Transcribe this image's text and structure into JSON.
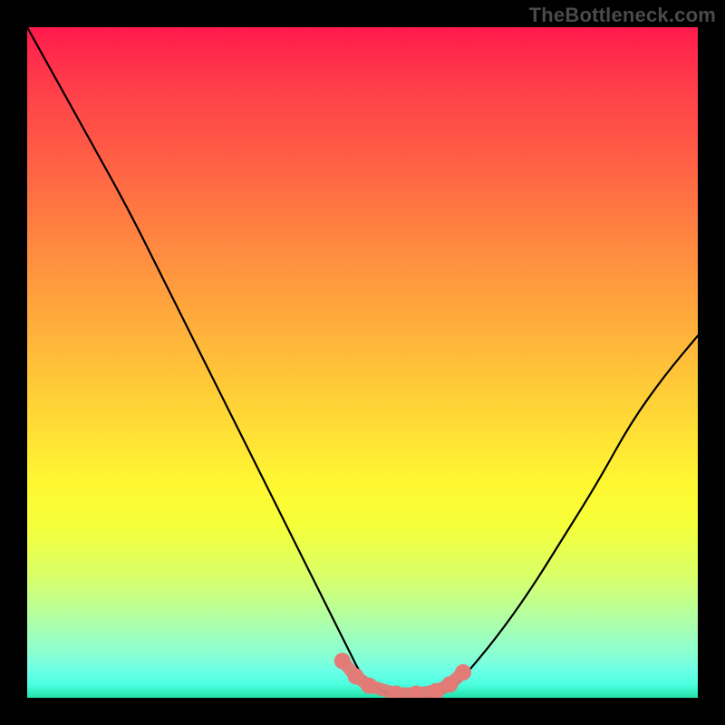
{
  "watermark": "TheBottleneck.com",
  "chart_data": {
    "type": "line",
    "title": "",
    "xlabel": "",
    "ylabel": "",
    "xlim": [
      0,
      100
    ],
    "ylim": [
      0,
      100
    ],
    "grid": false,
    "legend": false,
    "series": [
      {
        "name": "bottleneck-curve",
        "x": [
          0,
          5,
          10,
          15,
          20,
          25,
          30,
          35,
          40,
          45,
          48,
          50,
          53,
          55,
          57,
          60,
          63,
          65,
          70,
          75,
          80,
          85,
          90,
          95,
          100
        ],
        "values": [
          100,
          91,
          82,
          73,
          63,
          53,
          43,
          33,
          23,
          13,
          7,
          3,
          1,
          0,
          0,
          0,
          1,
          3,
          9,
          16,
          24,
          32,
          41,
          48,
          54
        ]
      },
      {
        "name": "good-zone-markers",
        "x": [
          47,
          49,
          51,
          55,
          58,
          61,
          63,
          65
        ],
        "values": [
          5.5,
          3.2,
          1.8,
          0.6,
          0.6,
          1.0,
          2.0,
          3.8
        ]
      }
    ],
    "annotations": []
  },
  "colors": {
    "curve_stroke": "#000000",
    "marker_fill": "#e27a76",
    "frame": "#000000"
  }
}
